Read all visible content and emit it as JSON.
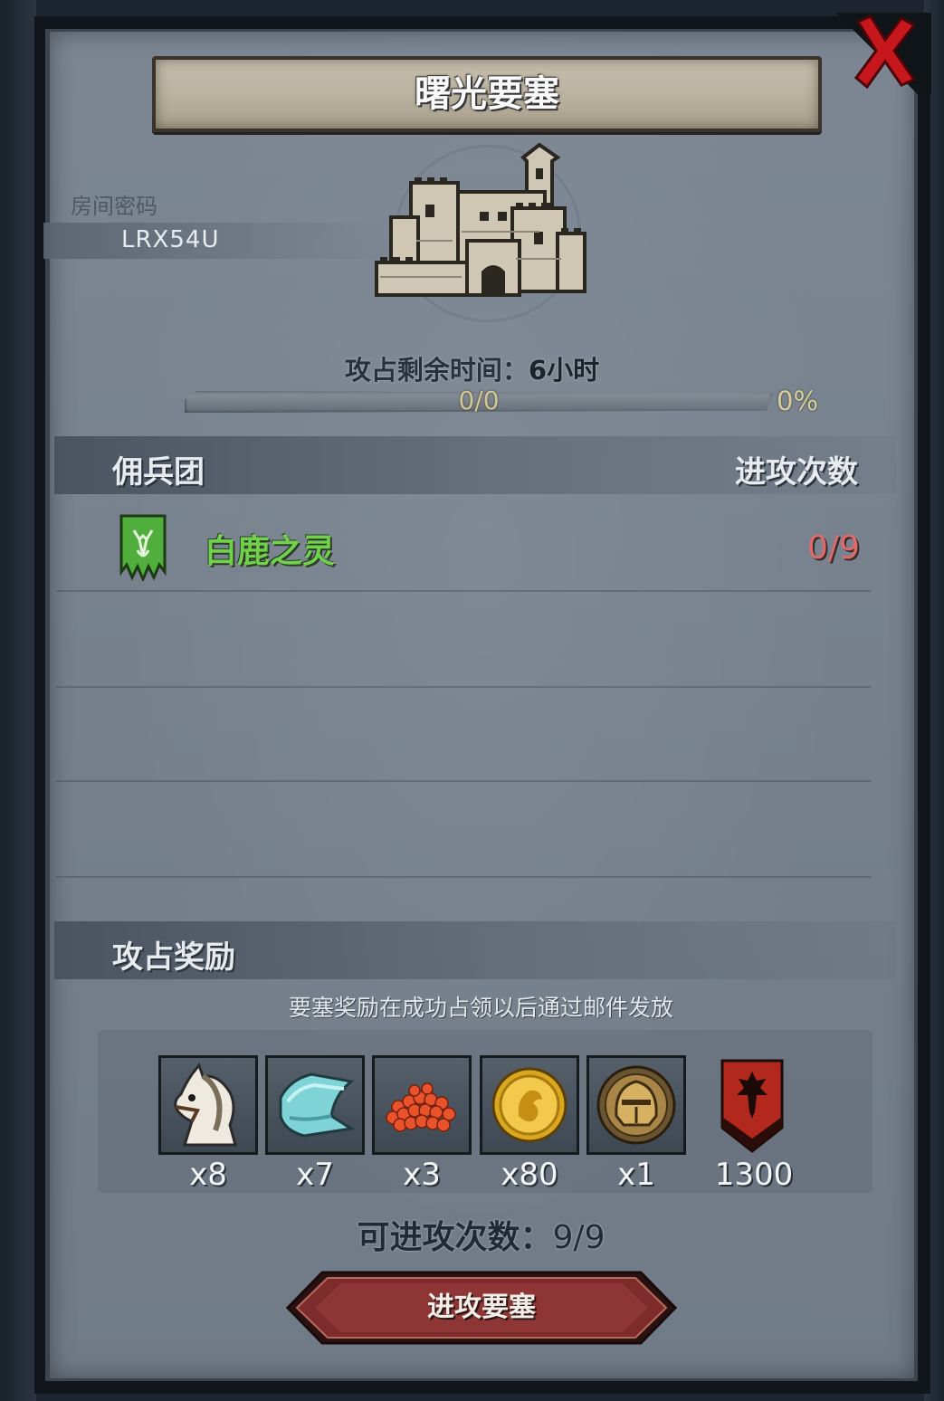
{
  "title": "曙光要塞",
  "room": {
    "label": "房间密码",
    "code": "LRX54U"
  },
  "time_remaining": {
    "label": "攻占剩余时间：",
    "value": "6小时"
  },
  "progress": {
    "text": "0/0",
    "percent_text": "0%",
    "fraction": 0
  },
  "mercenary_section": {
    "title": "佣兵团",
    "attacks_header": "进攻次数",
    "rows": [
      {
        "name": "白鹿之灵",
        "attacks": "0/9"
      }
    ]
  },
  "reward_section": {
    "title": "攻占奖励",
    "note": "要塞奖励在成功占领以后通过邮件发放",
    "items": [
      {
        "icon": "horse-icon",
        "qty": "x8"
      },
      {
        "icon": "cloth-icon",
        "qty": "x7"
      },
      {
        "icon": "berries-icon",
        "qty": "x3"
      },
      {
        "icon": "gold-coin-icon",
        "qty": "x80"
      },
      {
        "icon": "knight-medal-icon",
        "qty": "x1"
      },
      {
        "icon": "red-shield-icon",
        "qty": "1300"
      }
    ]
  },
  "available_attacks": {
    "label": "可进攻次数：",
    "value": "9/9"
  },
  "attack_button": "进攻要塞",
  "colors": {
    "merc_name": "#6fd24a",
    "attack_count": "#e06a6a",
    "close": "#c8161d"
  }
}
